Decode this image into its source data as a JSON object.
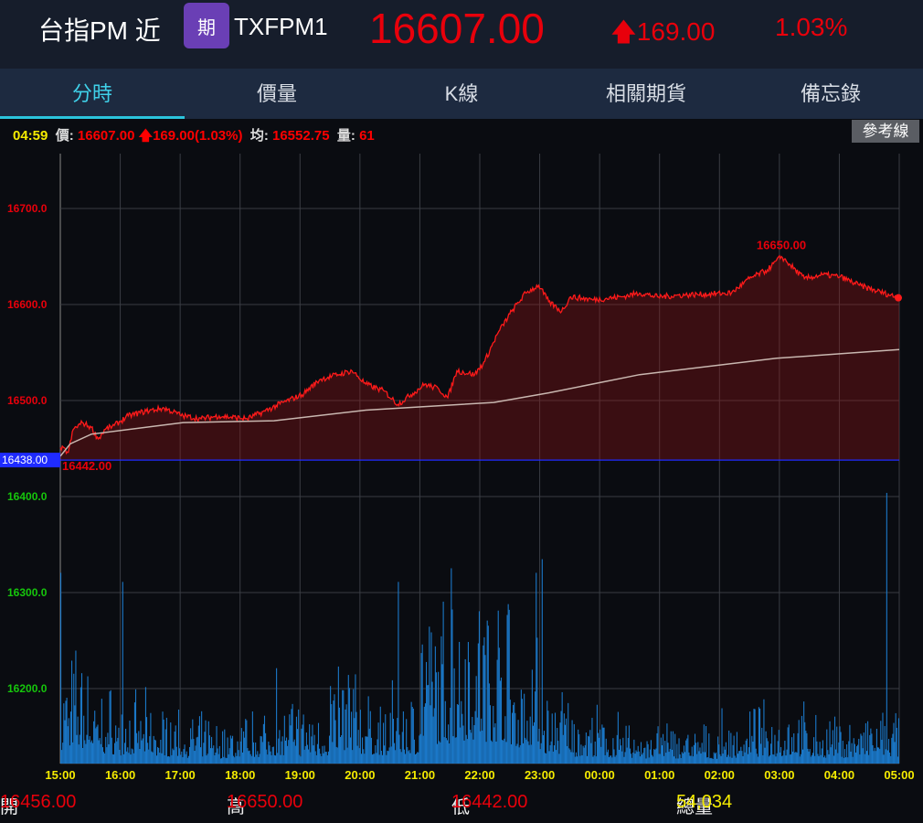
{
  "header": {
    "title": "台指PM 近",
    "badge": "期",
    "code": "TXFPM1",
    "price": "16607.00",
    "change_arrow": "up-arrow-icon",
    "change": "169.00",
    "percent": "1.03%"
  },
  "tabs": [
    {
      "label": "分時",
      "active": true
    },
    {
      "label": "價量"
    },
    {
      "label": "K線"
    },
    {
      "label": "相關期貨"
    },
    {
      "label": "備忘錄"
    }
  ],
  "info": {
    "time": "04:59",
    "price_label": "價:",
    "price": "16607.00",
    "change": "169.00(1.03%)",
    "avg_label": "均:",
    "avg": "16552.75",
    "vol_label": "量:",
    "vol": "61"
  },
  "ref_button": "參考線",
  "colors": {
    "up": "#e8000b",
    "down": "#16c60c",
    "line": "#ff1a1a",
    "avg": "#c9b7b0",
    "volume": "#1b78c8",
    "ref": "#1f2bff"
  },
  "chart_data": {
    "type": "line",
    "x_ticks": [
      "15:00",
      "16:00",
      "17:00",
      "18:00",
      "19:00",
      "20:00",
      "21:00",
      "22:00",
      "23:00",
      "00:00",
      "01:00",
      "02:00",
      "03:00",
      "04:00",
      "05:00"
    ],
    "y_ticks": [
      "16700.0",
      "16600.0",
      "16500.0",
      "16400.0",
      "16300.0",
      "16200.0"
    ],
    "y_tick_values": [
      16700,
      16600,
      16500,
      16400,
      16300,
      16200
    ],
    "reference": {
      "value": 16438,
      "label": "16438.00"
    },
    "high_label": "16650.00",
    "low_label": "16442.00",
    "ylim": [
      16121,
      16755
    ],
    "x_minutes_range": [
      0,
      840
    ],
    "price_series": [
      [
        0,
        16451
      ],
      [
        8,
        16446
      ],
      [
        13,
        16470
      ],
      [
        22,
        16477
      ],
      [
        31,
        16472
      ],
      [
        38,
        16460
      ],
      [
        45,
        16470
      ],
      [
        54,
        16474
      ],
      [
        68,
        16484
      ],
      [
        86,
        16489
      ],
      [
        104,
        16492
      ],
      [
        123,
        16484
      ],
      [
        141,
        16481
      ],
      [
        159,
        16484
      ],
      [
        187,
        16481
      ],
      [
        205,
        16489
      ],
      [
        223,
        16498
      ],
      [
        242,
        16506
      ],
      [
        260,
        16522
      ],
      [
        278,
        16527
      ],
      [
        292,
        16531
      ],
      [
        306,
        16517
      ],
      [
        324,
        16510
      ],
      [
        338,
        16496
      ],
      [
        351,
        16506
      ],
      [
        365,
        16517
      ],
      [
        379,
        16512
      ],
      [
        388,
        16503
      ],
      [
        397,
        16531
      ],
      [
        415,
        16527
      ],
      [
        425,
        16541
      ],
      [
        438,
        16570
      ],
      [
        452,
        16593
      ],
      [
        466,
        16612
      ],
      [
        479,
        16620
      ],
      [
        489,
        16603
      ],
      [
        502,
        16593
      ],
      [
        511,
        16608
      ],
      [
        534,
        16605
      ],
      [
        562,
        16608
      ],
      [
        580,
        16612
      ],
      [
        598,
        16608
      ],
      [
        626,
        16610
      ],
      [
        653,
        16611
      ],
      [
        672,
        16612
      ],
      [
        690,
        16627
      ],
      [
        708,
        16636
      ],
      [
        722,
        16650
      ],
      [
        731,
        16641
      ],
      [
        745,
        16627
      ],
      [
        763,
        16631
      ],
      [
        781,
        16629
      ],
      [
        800,
        16620
      ],
      [
        818,
        16614
      ],
      [
        840,
        16607
      ]
    ],
    "avg_series": [
      [
        0,
        16442
      ],
      [
        10,
        16455
      ],
      [
        31,
        16465
      ],
      [
        123,
        16477
      ],
      [
        214,
        16479
      ],
      [
        306,
        16490
      ],
      [
        434,
        16498
      ],
      [
        489,
        16508
      ],
      [
        580,
        16527
      ],
      [
        717,
        16544
      ],
      [
        840,
        16553
      ]
    ],
    "volume_profile_per_30min": [
      60,
      40,
      35,
      30,
      25,
      22,
      28,
      35,
      30,
      55,
      35,
      40,
      85,
      100,
      95,
      70,
      40,
      30,
      25,
      22,
      22,
      20,
      25,
      30,
      30,
      25,
      25,
      28
    ],
    "volume_spikes": [
      [
        0,
        210
      ],
      [
        62,
        200
      ],
      [
        216,
        105
      ],
      [
        338,
        200
      ],
      [
        391,
        215
      ],
      [
        476,
        210
      ],
      [
        482,
        225
      ],
      [
        827,
        298
      ]
    ],
    "volume_max_relative": 300
  },
  "footer": {
    "open_label": "開",
    "open": "16456.00",
    "high_label": "高",
    "high": "16650.00",
    "low_label": "低",
    "low": "16442.00",
    "vol_label": "總量",
    "vol": "54,034"
  }
}
